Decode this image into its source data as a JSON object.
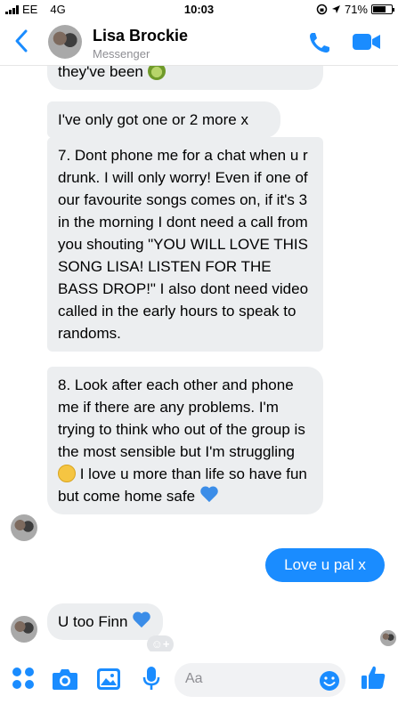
{
  "status_bar": {
    "carrier": "EE",
    "network": "4G",
    "time": "10:03",
    "battery": "71%",
    "battery_level": 0.71
  },
  "header": {
    "contact_name": "Lisa Brockie",
    "subtitle": "Messenger",
    "accent_color": "#1a8cff"
  },
  "messages": [
    {
      "from": "contact",
      "text": "they've been",
      "emoji": "kiwi"
    },
    {
      "from": "contact",
      "text": "I've only got one or 2 more x"
    },
    {
      "from": "contact",
      "text": "7. Dont phone me for a chat when u r drunk. I will only worry! Even if one of our favourite songs comes on, if it's 3 in the morning I dont need a call from you shouting \"YOU WILL LOVE THIS SONG LISA! LISTEN FOR THE BASS DROP!\" I also dont need video called in the early hours to speak to randoms."
    },
    {
      "from": "contact",
      "text_part1": "8. Look after each other and phone me if there are any problems. I'm trying to think who out of the group is the most sensible but I'm struggling",
      "text_part2": "I love u more than life so have fun but come home safe"
    },
    {
      "from": "me",
      "text": "Love u pal x"
    },
    {
      "from": "contact",
      "text": "U too Finn"
    }
  ],
  "composer": {
    "placeholder": "Aa",
    "icons": [
      "more-dots-icon",
      "camera-icon",
      "gallery-icon",
      "microphone-icon",
      "emoji-icon",
      "thumbs-up-icon"
    ]
  }
}
